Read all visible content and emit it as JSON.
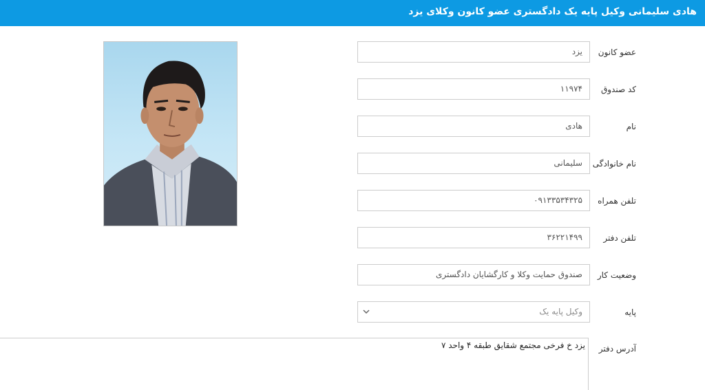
{
  "header": {
    "title": "هادی سلیمانی وکیل پایه یک دادگستری عضو کانون وکلای یزد"
  },
  "colors": {
    "header_bg": "#0d9ae3",
    "header_text": "#ffffff",
    "field_border": "#cccccc"
  },
  "photo": {
    "icon": "person-photo"
  },
  "form": {
    "member_of": {
      "label": "عضو کانون",
      "value": "یزد"
    },
    "fund_code": {
      "label": "کد صندوق",
      "value": "۱۱۹۷۴"
    },
    "first_name": {
      "label": "نام",
      "value": "هادی"
    },
    "last_name": {
      "label": "نام خانوادگی",
      "value": "سلیمانی"
    },
    "mobile": {
      "label": "تلفن همراه",
      "value": "۰۹۱۳۳۵۳۴۳۲۵"
    },
    "office_phone": {
      "label": "تلفن دفتر",
      "value": "۳۶۲۲۱۴۹۹"
    },
    "work_status": {
      "label": "وضعیت کار",
      "value": "صندوق حمایت وکلا و کارگشایان دادگستری"
    },
    "grade": {
      "label": "پایه",
      "value": "وکیل پایه یک",
      "icon": "chevron-down-icon"
    },
    "office_address": {
      "label": "آدرس دفتر",
      "value": "یزد خ فرخی مجتمع شقایق طبقه ۴ واحد ۷"
    }
  }
}
